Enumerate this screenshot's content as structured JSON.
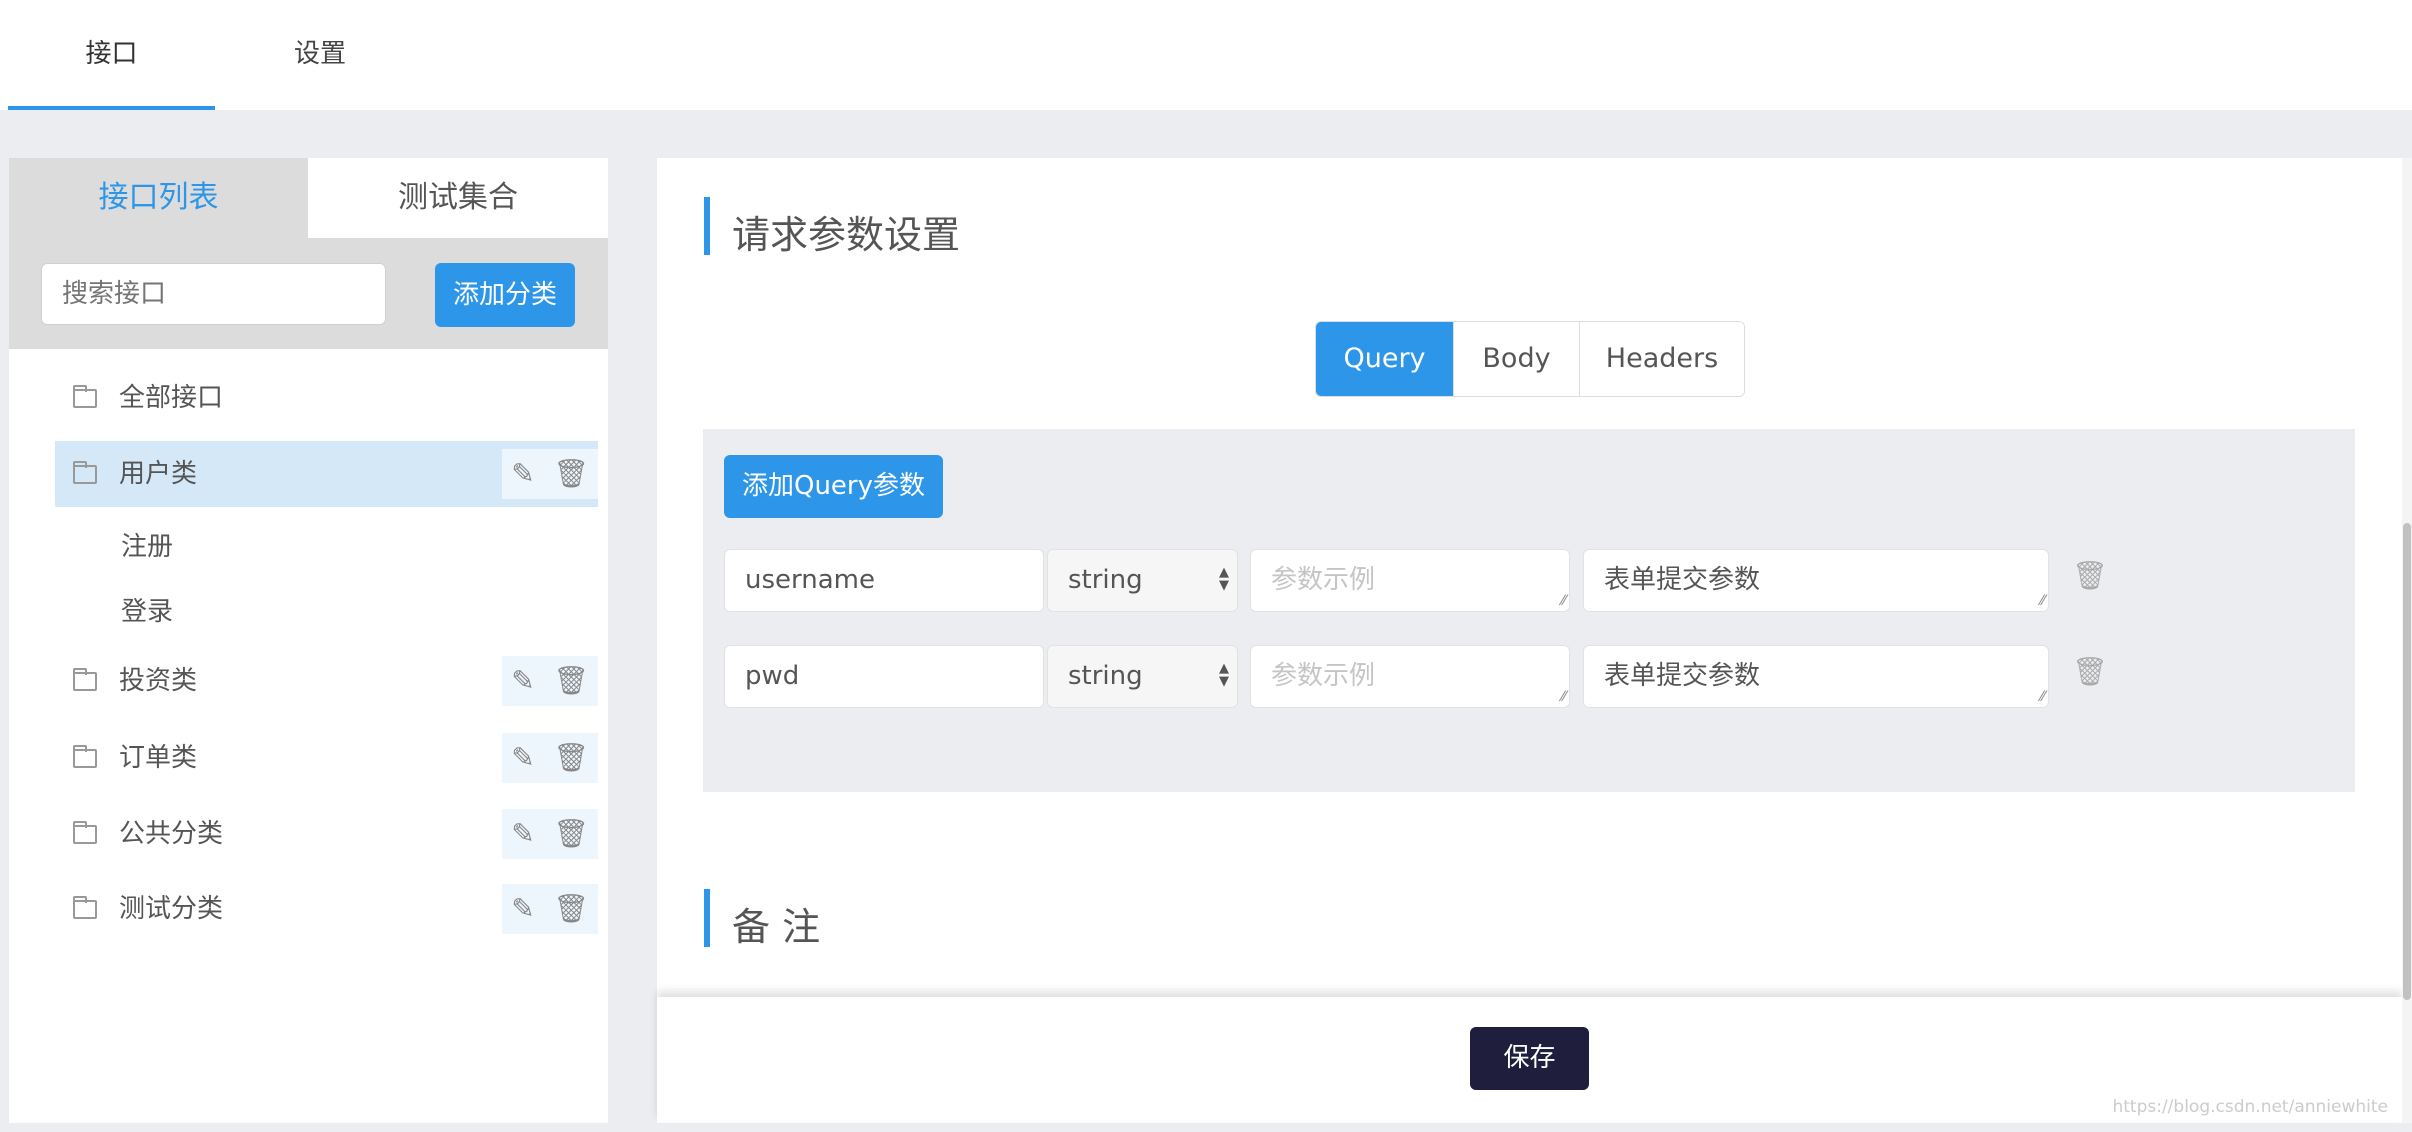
{
  "topnav": {
    "tabs": [
      {
        "label": "接口",
        "active": true
      },
      {
        "label": "设置",
        "active": false
      }
    ]
  },
  "sidebar": {
    "tabs": [
      {
        "label": "接口列表",
        "active": true
      },
      {
        "label": "测试集合",
        "active": false
      }
    ],
    "search_placeholder": "搜索接口",
    "add_category_label": "添加分类",
    "tree": [
      {
        "label": "全部接口"
      },
      {
        "label": "用户类",
        "selected": true,
        "children": [
          "注册",
          "登录"
        ]
      },
      {
        "label": "投资类"
      },
      {
        "label": "订单类"
      },
      {
        "label": "公共分类"
      },
      {
        "label": "测试分类"
      }
    ]
  },
  "main": {
    "section_title": "请求参数设置",
    "tabs": [
      {
        "label": "Query",
        "active": true
      },
      {
        "label": "Body"
      },
      {
        "label": "Headers"
      }
    ],
    "add_query_label": "添加Query参数",
    "params": [
      {
        "name": "username",
        "type": "string",
        "example_placeholder": "参数示例",
        "description": "表单提交参数"
      },
      {
        "name": "pwd",
        "type": "string",
        "example_placeholder": "参数示例",
        "description": "表单提交参数"
      }
    ],
    "notes_title": "备 注"
  },
  "footer": {
    "save_label": "保存",
    "watermark": "https://blog.csdn.net/anniewhite"
  },
  "colors": {
    "accent": "#2d96e8",
    "save": "#1f1f3d",
    "background": "#ecedf1"
  }
}
